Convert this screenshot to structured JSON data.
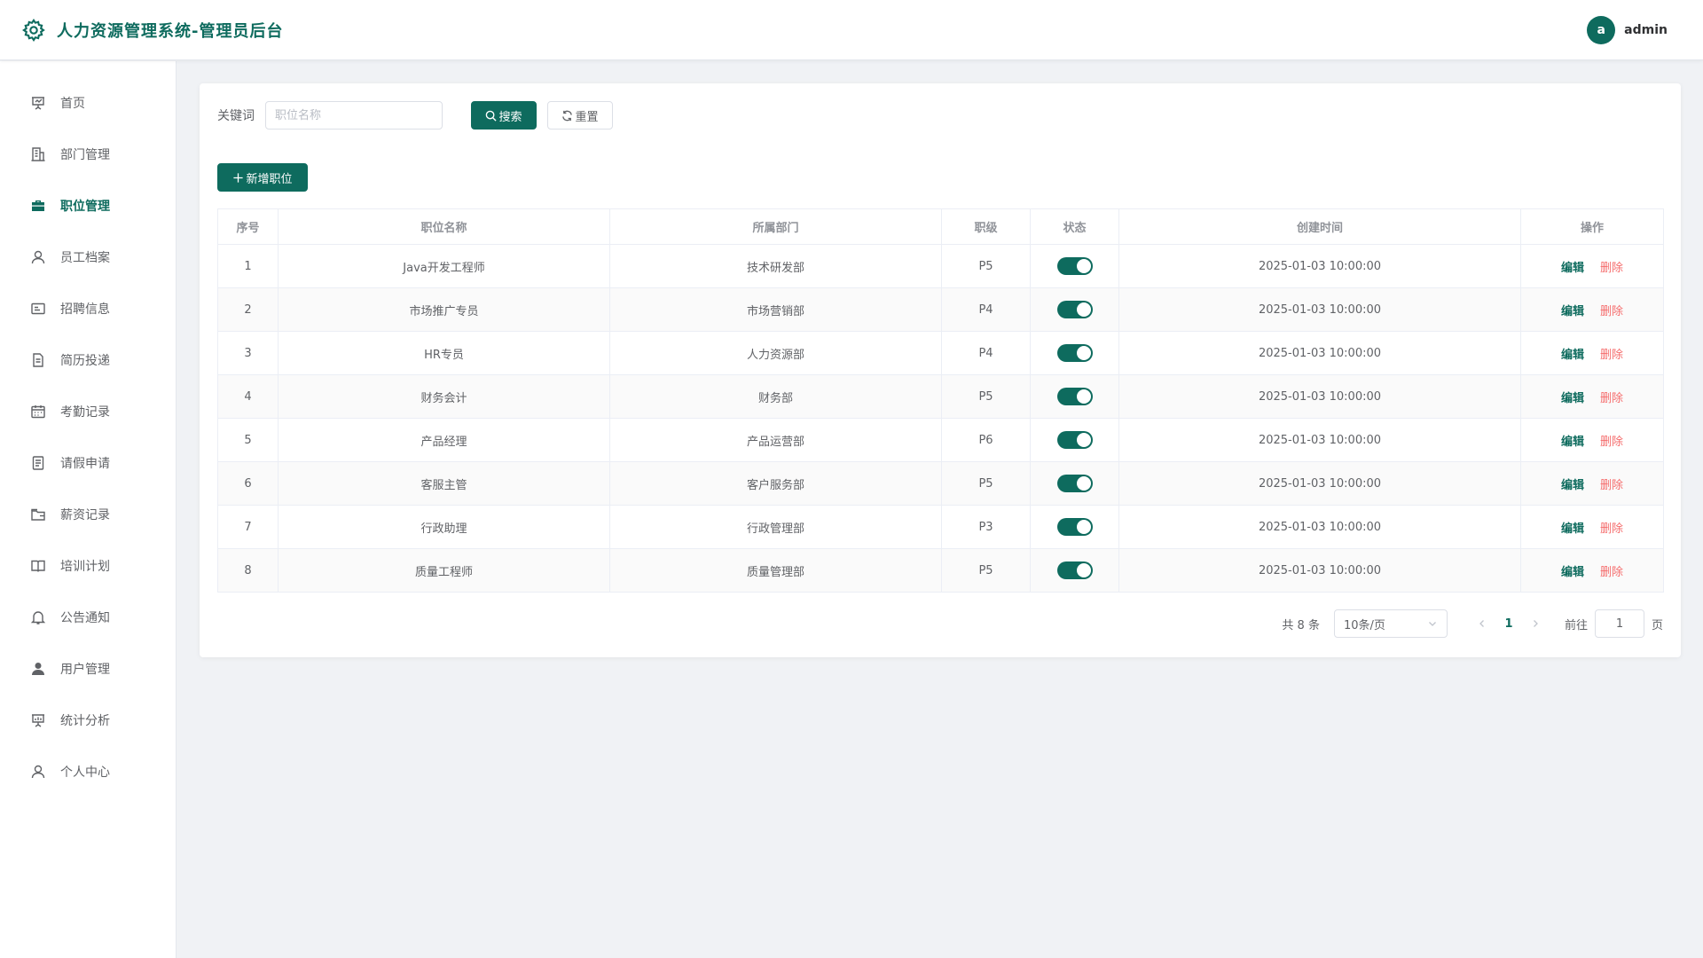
{
  "header": {
    "title": "人力资源管理系统-管理员后台",
    "avatar_letter": "a",
    "username": "admin"
  },
  "sidebar": {
    "items": [
      {
        "label": "首页",
        "icon": "presentation-icon",
        "active": false
      },
      {
        "label": "部门管理",
        "icon": "building-icon",
        "active": false
      },
      {
        "label": "职位管理",
        "icon": "briefcase-icon",
        "active": true
      },
      {
        "label": "员工档案",
        "icon": "user-icon",
        "active": false
      },
      {
        "label": "招聘信息",
        "icon": "postcard-icon",
        "active": false
      },
      {
        "label": "简历投递",
        "icon": "document-icon",
        "active": false
      },
      {
        "label": "考勤记录",
        "icon": "calendar-icon",
        "active": false
      },
      {
        "label": "请假申请",
        "icon": "tickets-icon",
        "active": false
      },
      {
        "label": "薪资记录",
        "icon": "wallet-icon",
        "active": false
      },
      {
        "label": "培训计划",
        "icon": "book-icon",
        "active": false
      },
      {
        "label": "公告通知",
        "icon": "bell-icon",
        "active": false
      },
      {
        "label": "用户管理",
        "icon": "user-filled-icon",
        "active": false
      },
      {
        "label": "统计分析",
        "icon": "data-board-icon",
        "active": false
      },
      {
        "label": "个人中心",
        "icon": "user-icon",
        "active": false
      }
    ]
  },
  "search": {
    "keyword_label": "关键词",
    "placeholder": "职位名称",
    "value": "",
    "search_label": "搜索",
    "reset_label": "重置"
  },
  "toolbar": {
    "add_label": "新增职位"
  },
  "table": {
    "columns": [
      "序号",
      "职位名称",
      "所属部门",
      "职级",
      "状态",
      "创建时间",
      "操作"
    ],
    "rows": [
      {
        "index": "1",
        "name": "Java开发工程师",
        "dept": "技术研发部",
        "level": "P5",
        "status": true,
        "created": "2025-01-03 10:00:00"
      },
      {
        "index": "2",
        "name": "市场推广专员",
        "dept": "市场营销部",
        "level": "P4",
        "status": true,
        "created": "2025-01-03 10:00:00"
      },
      {
        "index": "3",
        "name": "HR专员",
        "dept": "人力资源部",
        "level": "P4",
        "status": true,
        "created": "2025-01-03 10:00:00"
      },
      {
        "index": "4",
        "name": "财务会计",
        "dept": "财务部",
        "level": "P5",
        "status": true,
        "created": "2025-01-03 10:00:00"
      },
      {
        "index": "5",
        "name": "产品经理",
        "dept": "产品运营部",
        "level": "P6",
        "status": true,
        "created": "2025-01-03 10:00:00"
      },
      {
        "index": "6",
        "name": "客服主管",
        "dept": "客户服务部",
        "level": "P5",
        "status": true,
        "created": "2025-01-03 10:00:00"
      },
      {
        "index": "7",
        "name": "行政助理",
        "dept": "行政管理部",
        "level": "P3",
        "status": true,
        "created": "2025-01-03 10:00:00"
      },
      {
        "index": "8",
        "name": "质量工程师",
        "dept": "质量管理部",
        "level": "P5",
        "status": true,
        "created": "2025-01-03 10:00:00"
      }
    ],
    "edit_label": "编辑",
    "delete_label": "删除"
  },
  "pagination": {
    "total_text": "共 8 条",
    "page_size": "10条/页",
    "current_page": "1",
    "goto_label": "前往",
    "goto_value": "1",
    "page_suffix": "页"
  },
  "colors": {
    "primary": "#0e6b5e",
    "danger": "#f56c6c",
    "background": "#f0f2f5"
  }
}
